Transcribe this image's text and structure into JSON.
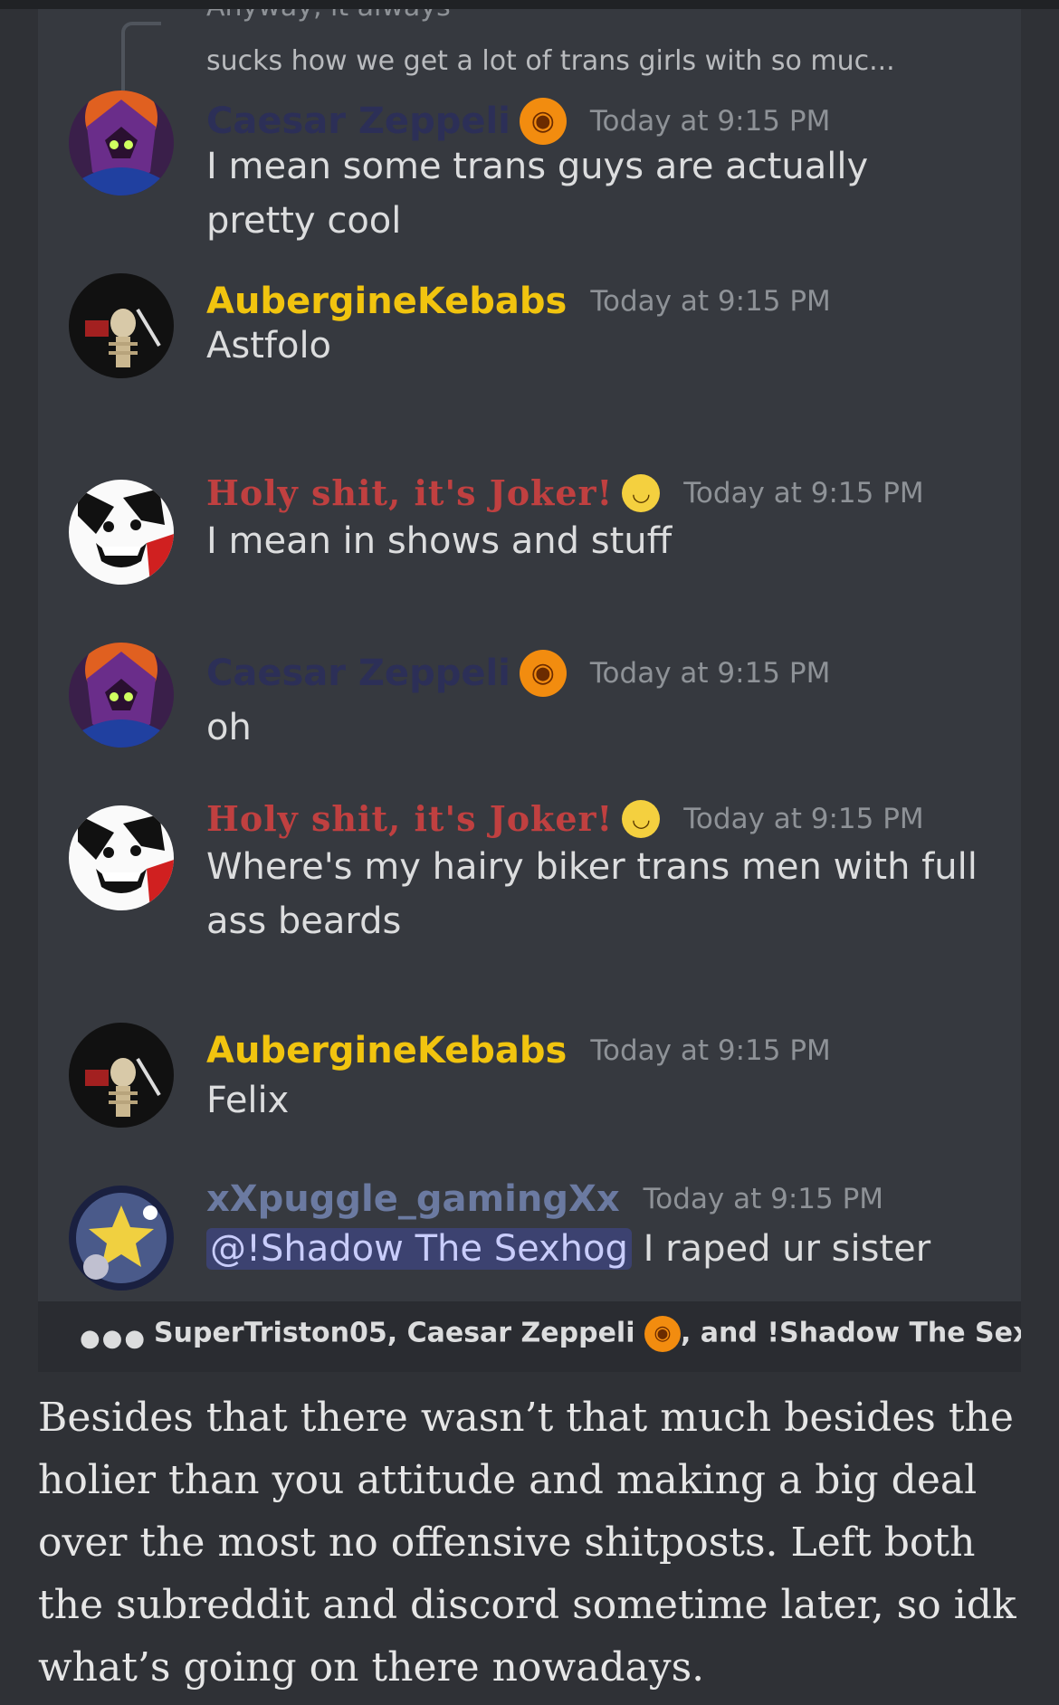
{
  "reply_preview": {
    "cut_text": "Anyway, it always",
    "text": "sucks how we get a lot of trans girls with so muc..."
  },
  "messages": [
    {
      "username": "Caesar Zeppeli",
      "badge": "pumpkin",
      "time": "Today at 9:15 PM",
      "text": "I mean some trans guys are actually pretty cool",
      "color": "#2c2f57"
    },
    {
      "username": "AubergineKebabs",
      "time": "Today at 9:15 PM",
      "text": "Astfolo",
      "color": "#f1c40f"
    },
    {
      "username": "Holy shit, it's Joker!",
      "badge": "laugh",
      "time": "Today at 9:15 PM",
      "text": "I mean in shows and stuff",
      "color": "#c04040"
    },
    {
      "username": "Caesar Zeppeli",
      "badge": "pumpkin",
      "time": "Today at 9:15 PM",
      "text": "oh",
      "color": "#2c2f57"
    },
    {
      "username": "Holy shit, it's Joker!",
      "badge": "laugh",
      "time": "Today at 9:15 PM",
      "text": "Where's my hairy biker trans men with full ass beards",
      "color": "#c04040"
    },
    {
      "username": "AubergineKebabs",
      "time": "Today at 9:15 PM",
      "text": "Felix",
      "color": "#f1c40f"
    },
    {
      "username": "xXpuggle_gamingXx",
      "time": "Today at 9:15 PM",
      "mention": "@!Shadow The Sexhog",
      "text": "I raped ur sister",
      "color": "#6b7aa1"
    }
  ],
  "typing": {
    "names_before": "SuperTriston05, Caesar Zeppeli",
    "names_after": ", and !Shadow The Sexhog are"
  },
  "post_text": "Besides that there wasn’t that much besides the holier than you attitude and making a big deal over the most no offensive shitposts. Left both the subreddit and discord sometime later, so idk what’s going on there nowadays."
}
